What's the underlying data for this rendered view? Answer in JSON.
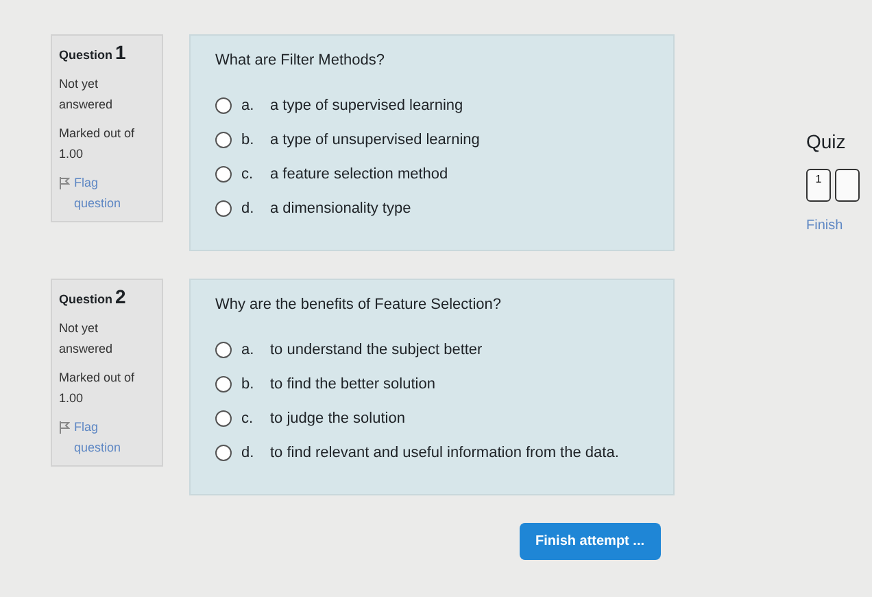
{
  "questions": [
    {
      "label": "Question",
      "number": "1",
      "status": "Not yet answered",
      "marked": "Marked out of 1.00",
      "flag": "Flag question",
      "text": "What are Filter Methods?",
      "options": [
        {
          "letter": "a.",
          "text": "a type of supervised learning",
          "selected": false
        },
        {
          "letter": "b.",
          "text": "a type of unsupervised learning",
          "selected": false
        },
        {
          "letter": "c.",
          "text": "a feature selection method",
          "selected": false
        },
        {
          "letter": "d.",
          "text": "a dimensionality type",
          "selected": false
        }
      ]
    },
    {
      "label": "Question",
      "number": "2",
      "status": "Not yet answered",
      "marked": "Marked out of 1.00",
      "flag": "Flag question",
      "text": "Why are the benefits of Feature Selection?",
      "options": [
        {
          "letter": "a.",
          "text": "to understand the subject better",
          "selected": false
        },
        {
          "letter": "b.",
          "text": "to find the better solution",
          "selected": false
        },
        {
          "letter": "c.",
          "text": "to judge the solution",
          "selected": false
        },
        {
          "letter": "d.",
          "text": "to find relevant and useful information from the data.",
          "selected": false
        }
      ]
    }
  ],
  "submit_button": "Finish attempt ...",
  "quiz_nav": {
    "title": "Quiz",
    "buttons": [
      {
        "kind": "numbered",
        "label": "1"
      },
      {
        "kind": "cut"
      }
    ],
    "finish_link": "Finish"
  }
}
